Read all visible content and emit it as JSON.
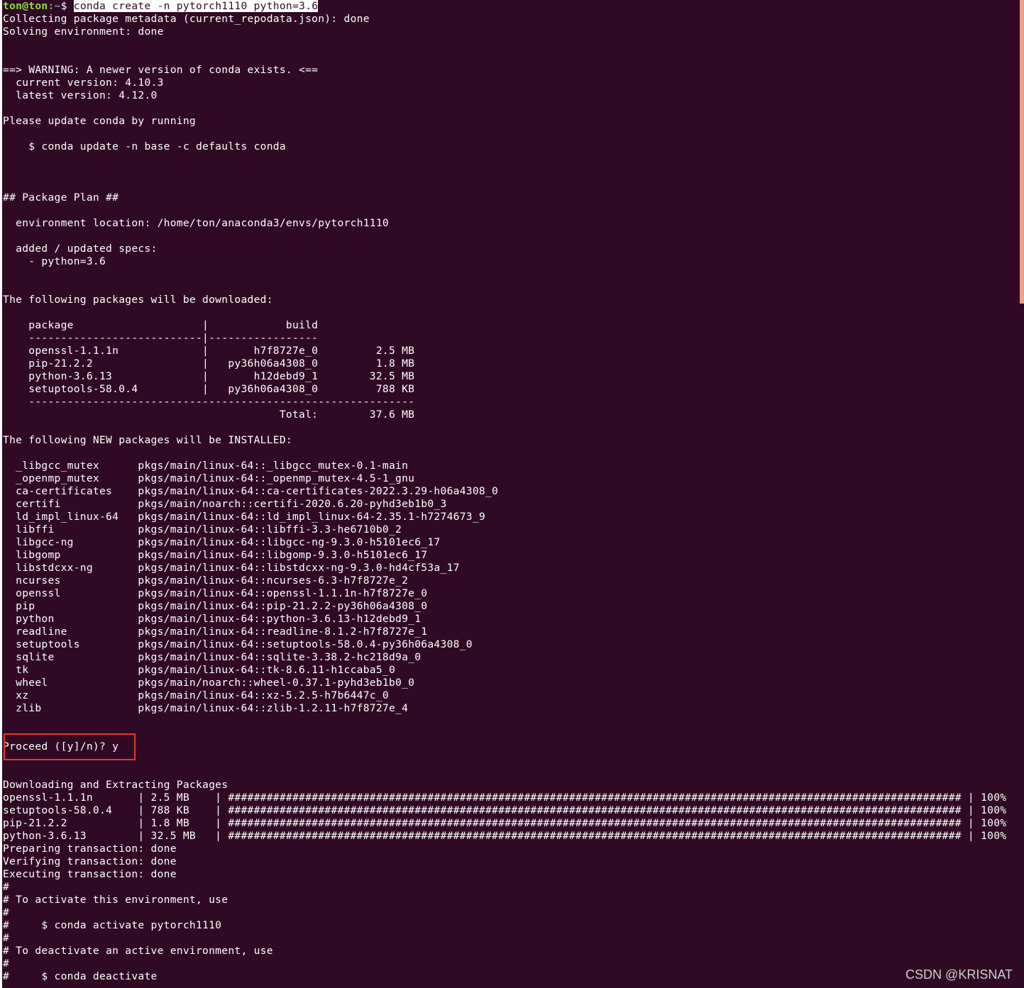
{
  "prompt": {
    "user_host": "ton@ton",
    "path": ":~",
    "symbol": "$ ",
    "command": "conda create -n pytorch1110 python=3.6"
  },
  "output_lines": [
    "Collecting package metadata (current_repodata.json): done",
    "Solving environment: done",
    "",
    "",
    "==> WARNING: A newer version of conda exists. <==",
    "  current version: 4.10.3",
    "  latest version: 4.12.0",
    "",
    "Please update conda by running",
    "",
    "    $ conda update -n base -c defaults conda",
    "",
    "",
    "",
    "## Package Plan ##",
    "",
    "  environment location: /home/ton/anaconda3/envs/pytorch1110",
    "",
    "  added / updated specs:",
    "    - python=3.6",
    "",
    "",
    "The following packages will be downloaded:",
    "",
    "    package                    |            build",
    "    ---------------------------|-----------------",
    "    openssl-1.1.1n             |       h7f8727e_0         2.5 MB",
    "    pip-21.2.2                 |   py36h06a4308_0         1.8 MB",
    "    python-3.6.13              |       h12debd9_1        32.5 MB",
    "    setuptools-58.0.4          |   py36h06a4308_0         788 KB",
    "    ------------------------------------------------------------",
    "                                           Total:        37.6 MB",
    "",
    "The following NEW packages will be INSTALLED:",
    "",
    "  _libgcc_mutex      pkgs/main/linux-64::_libgcc_mutex-0.1-main",
    "  _openmp_mutex      pkgs/main/linux-64::_openmp_mutex-4.5-1_gnu",
    "  ca-certificates    pkgs/main/linux-64::ca-certificates-2022.3.29-h06a4308_0",
    "  certifi            pkgs/main/noarch::certifi-2020.6.20-pyhd3eb1b0_3",
    "  ld_impl_linux-64   pkgs/main/linux-64::ld_impl_linux-64-2.35.1-h7274673_9",
    "  libffi             pkgs/main/linux-64::libffi-3.3-he6710b0_2",
    "  libgcc-ng          pkgs/main/linux-64::libgcc-ng-9.3.0-h5101ec6_17",
    "  libgomp            pkgs/main/linux-64::libgomp-9.3.0-h5101ec6_17",
    "  libstdcxx-ng       pkgs/main/linux-64::libstdcxx-ng-9.3.0-hd4cf53a_17",
    "  ncurses            pkgs/main/linux-64::ncurses-6.3-h7f8727e_2",
    "  openssl            pkgs/main/linux-64::openssl-1.1.1n-h7f8727e_0",
    "  pip                pkgs/main/linux-64::pip-21.2.2-py36h06a4308_0",
    "  python             pkgs/main/linux-64::python-3.6.13-h12debd9_1",
    "  readline           pkgs/main/linux-64::readline-8.1.2-h7f8727e_1",
    "  setuptools         pkgs/main/linux-64::setuptools-58.0.4-py36h06a4308_0",
    "  sqlite             pkgs/main/linux-64::sqlite-3.38.2-hc218d9a_0",
    "  tk                 pkgs/main/linux-64::tk-8.6.11-h1ccaba5_0",
    "  wheel              pkgs/main/noarch::wheel-0.37.1-pyhd3eb1b0_0",
    "  xz                 pkgs/main/linux-64::xz-5.2.5-h7b6447c_0",
    "  zlib               pkgs/main/linux-64::zlib-1.2.11-h7f8727e_4",
    "",
    "",
    "Proceed ([y]/n)? y",
    "",
    "",
    "Downloading and Extracting Packages",
    "openssl-1.1.1n       | 2.5 MB    | ################################################################################################################## | 100%",
    "setuptools-58.0.4    | 788 KB    | ################################################################################################################## | 100%",
    "pip-21.2.2           | 1.8 MB    | ################################################################################################################## | 100%",
    "python-3.6.13        | 32.5 MB   | ################################################################################################################## | 100%",
    "Preparing transaction: done",
    "Verifying transaction: done",
    "Executing transaction: done",
    "#",
    "# To activate this environment, use",
    "#",
    "#     $ conda activate pytorch1110",
    "#",
    "# To deactivate an active environment, use",
    "#",
    "#     $ conda deactivate"
  ],
  "highlighted_line": "Proceed ([y]/n)? y",
  "watermark": "CSDN @KRISNAT",
  "colors": {
    "background": "#300a24",
    "text": "#ffffff",
    "prompt_user": "#8ae234",
    "prompt_path": "#729fcf",
    "highlight_box": "#e03a32",
    "scrollbar": "#f0a081"
  }
}
